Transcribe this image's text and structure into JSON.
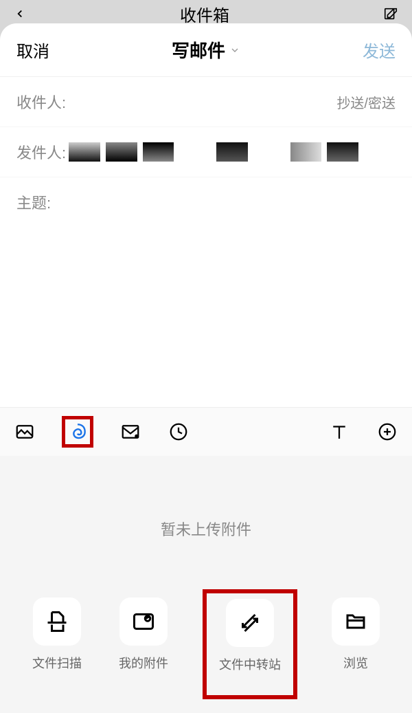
{
  "background": {
    "title": "收件箱"
  },
  "header": {
    "cancel": "取消",
    "title": "写邮件",
    "send": "发送"
  },
  "fields": {
    "recipient_label": "收件人:",
    "cc_bcc": "抄送/密送",
    "sender_label": "发件人:",
    "subject_label": "主题:"
  },
  "toolbar": {
    "image_icon": "image-icon",
    "attachment_icon": "attachment-icon",
    "email_icon": "email-icon",
    "clock_icon": "clock-icon",
    "text_icon": "text-icon",
    "plus_icon": "plus-icon"
  },
  "attachment_panel": {
    "empty_text": "暂未上传附件",
    "options": [
      {
        "label": "文件扫描"
      },
      {
        "label": "我的附件"
      },
      {
        "label": "文件中转站"
      },
      {
        "label": "浏览"
      }
    ]
  }
}
